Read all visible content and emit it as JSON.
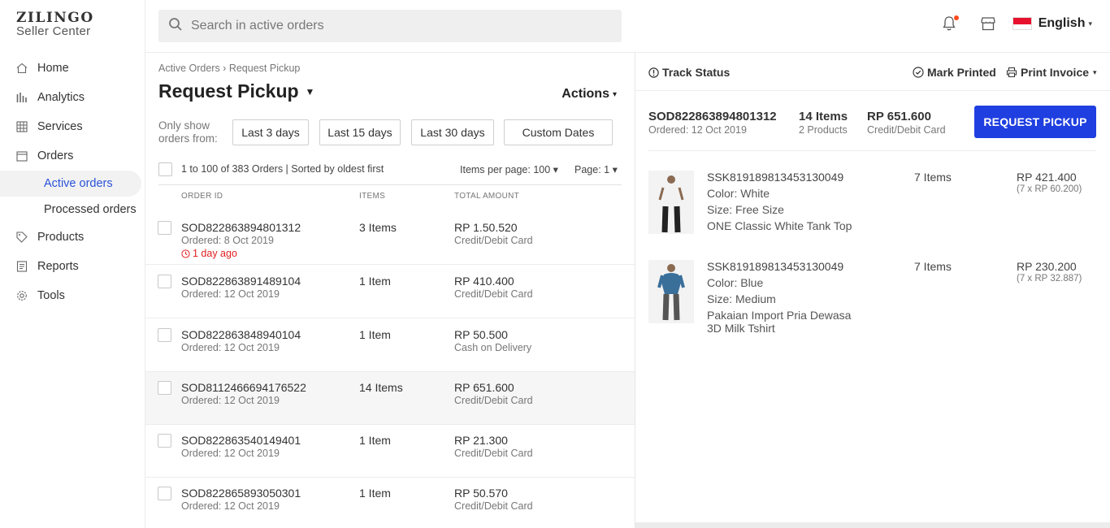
{
  "brand": {
    "name": "ZILINGO",
    "sub": "Seller Center"
  },
  "search": {
    "placeholder": "Search in active orders"
  },
  "header": {
    "language": "English"
  },
  "nav": {
    "home": "Home",
    "analytics": "Analytics",
    "services": "Services",
    "orders": "Orders",
    "active_orders": "Active orders",
    "processed_orders": "Processed orders",
    "products": "Products",
    "reports": "Reports",
    "tools": "Tools"
  },
  "list": {
    "breadcrumb": "Active Orders › Request Pickup",
    "title": "Request Pickup",
    "actions": "Actions",
    "filter_label": "Only show orders from:",
    "filters": [
      "Last 3 days",
      "Last 15 days",
      "Last 30 days",
      "Custom Dates"
    ],
    "count_text": "1 to 100 of 383 Orders | Sorted by oldest first",
    "items_per_page": "Items per page: 100",
    "page": "Page: 1",
    "columns": {
      "order_id": "ORDER ID",
      "items": "ITEMS",
      "total": "TOTAL AMOUNT"
    },
    "orders": [
      {
        "id": "SOD822863894801312",
        "date": "Ordered: 8 Oct 2019",
        "late": "1 day ago",
        "items": "3 Items",
        "amount": "RP 1.50.520",
        "payment": "Credit/Debit Card"
      },
      {
        "id": "SOD822863891489104",
        "date": "Ordered: 12 Oct 2019",
        "items": "1 Item",
        "amount": "RP 410.400",
        "payment": "Credit/Debit Card"
      },
      {
        "id": "SOD822863848940104",
        "date": "Ordered: 12 Oct 2019",
        "items": "1 Item",
        "amount": "RP 50.500",
        "payment": "Cash on Delivery"
      },
      {
        "id": "SOD8112466694176522",
        "date": "Ordered: 12 Oct 2019",
        "items": "14 Items",
        "amount": "RP 651.600",
        "payment": "Credit/Debit Card"
      },
      {
        "id": "SOD822863540149401",
        "date": "Ordered: 12 Oct 2019",
        "items": "1 Item",
        "amount": "RP 21.300",
        "payment": "Credit/Debit Card"
      },
      {
        "id": "SOD822865893050301",
        "date": "Ordered: 12 Oct 2019",
        "items": "1 Item",
        "amount": "RP 50.570",
        "payment": "Credit/Debit Card"
      }
    ]
  },
  "detail": {
    "track_status": "Track Status",
    "mark_printed": "Mark Printed",
    "print_invoice": "Print Invoice",
    "order_id": "SOD822863894801312",
    "order_date": "Ordered: 12 Oct 2019",
    "items": "14 Items",
    "products": "2 Products",
    "amount": "RP 651.600",
    "payment": "Credit/Debit Card",
    "request_pickup": "REQUEST PICKUP",
    "products_list": [
      {
        "sku": "SSK819189813453130049",
        "color": "Color: White",
        "size": "Size: Free Size",
        "name": "ONE Classic White Tank Top",
        "name2": "",
        "qty": "7 Items",
        "price": "RP 421.400",
        "unit": "(7 x RP 60.200)",
        "shirt": "#f2f2f2"
      },
      {
        "sku": "SSK819189813453130049",
        "color": "Color: Blue",
        "size": "Size: Medium",
        "name": "Pakaian Import Pria Dewasa",
        "name2": "3D Milk Tshirt",
        "qty": "7 Items",
        "price": "RP 230.200",
        "unit": "(7 x RP 32.887)",
        "shirt": "#3a6f9a"
      }
    ]
  }
}
